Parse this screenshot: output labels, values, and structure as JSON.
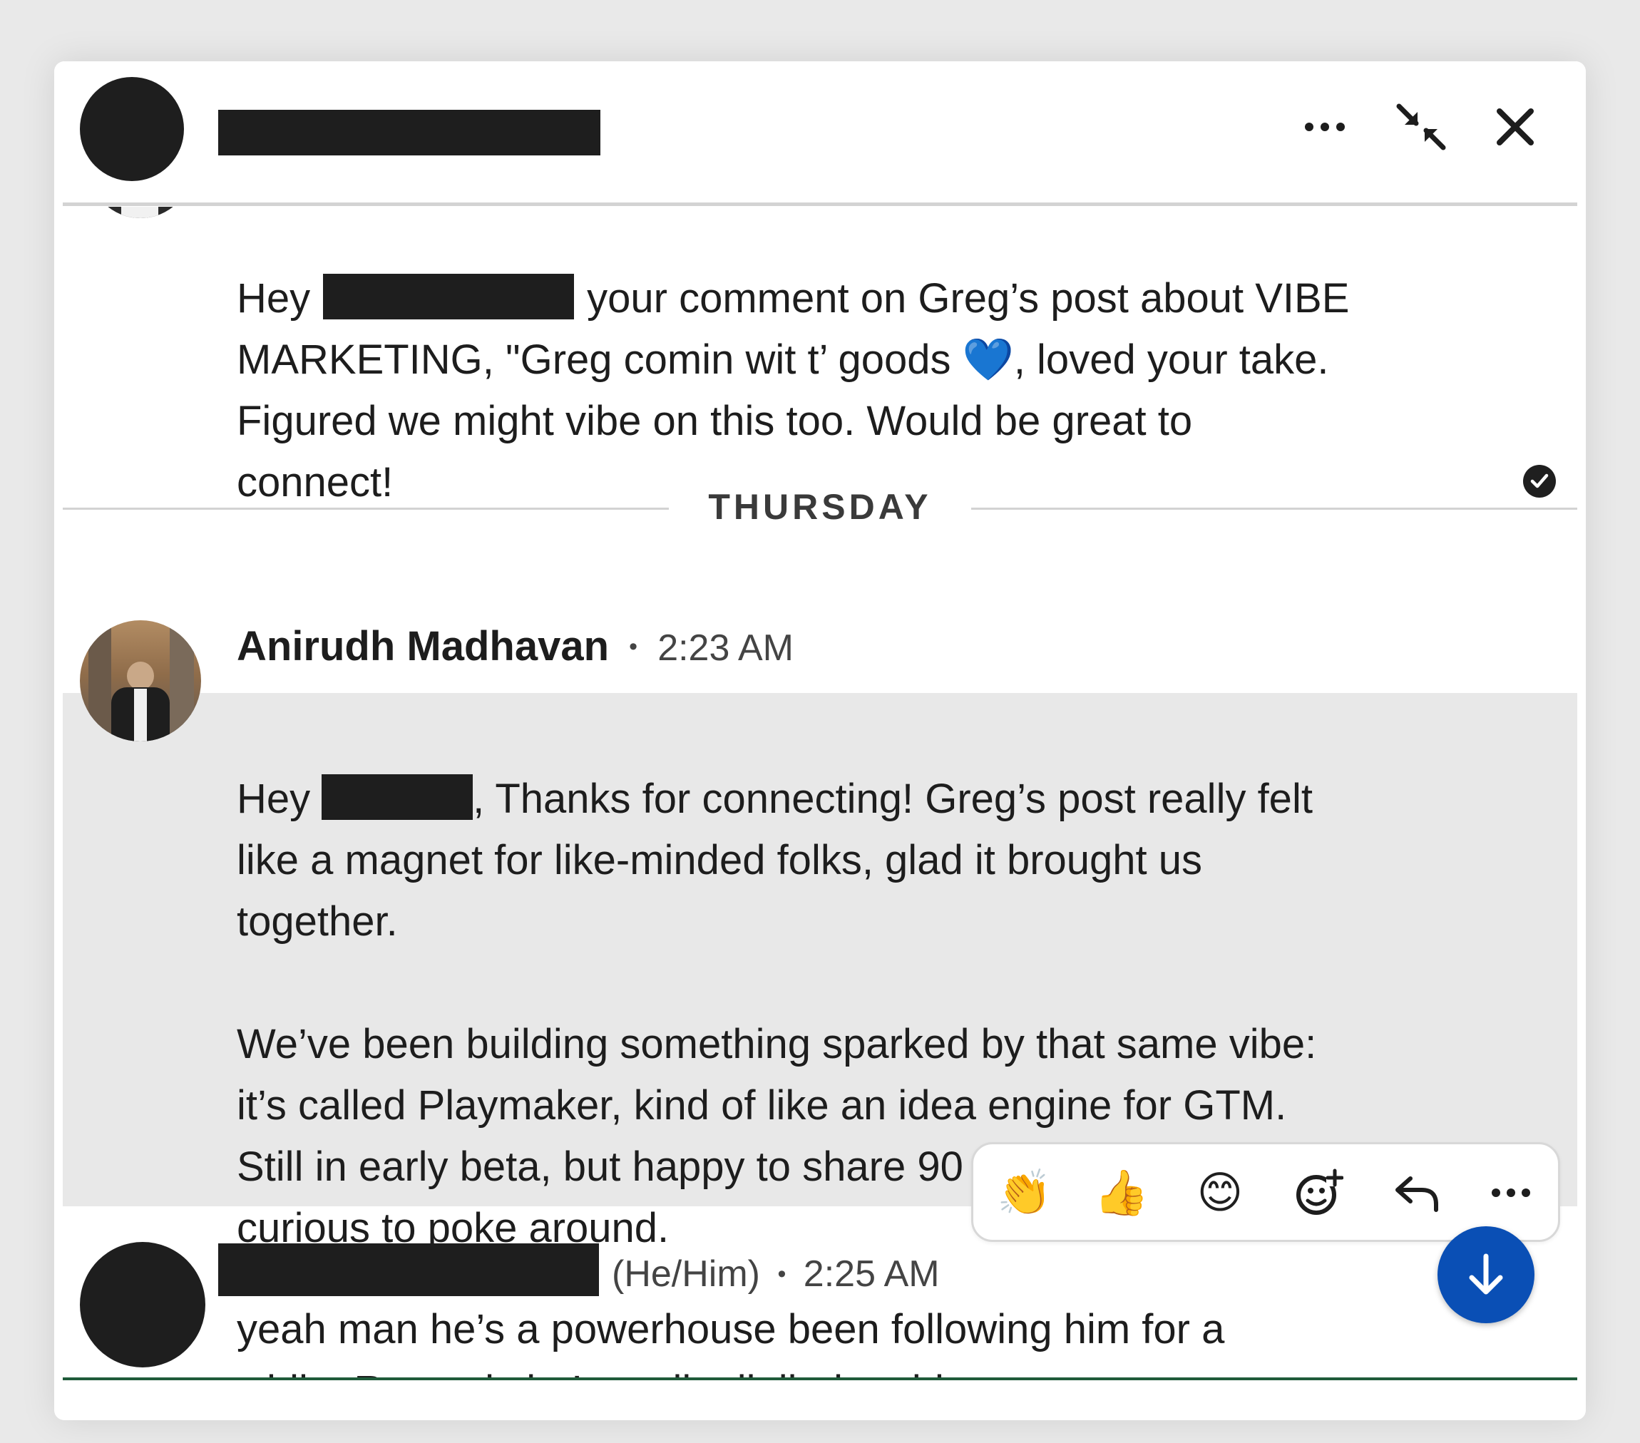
{
  "header": {
    "more_label": "More options",
    "minimize_label": "Minimize",
    "close_label": "Close"
  },
  "messages": [
    {
      "body_start": "Hey",
      "body_rest": "your comment on Greg’s post about VIBE\nMARKETING, \"Greg comin wit t’ goods 💙, loved your take.\nFigured we might vibe on this too. Would be great to\nconnect!"
    },
    {
      "sender": "Anirudh Madhavan",
      "time": "2:23 AM",
      "body_start": "Hey",
      "body_rest": ", Thanks for connecting! Greg’s post really felt\nlike a magnet for like-minded folks, glad it brought us\ntogether.\n\nWe’ve been building something sparked by that same vibe:\nit’s called Playmaker, kind of like an idea engine for GTM.\nStill in early beta, but happy to share 90 days free if you’re\ncurious to poke around."
    },
    {
      "pronouns": "(He/Him)",
      "time": "2:25 AM",
      "body": "yeah man he’s a powerhouse been following him for a\nwhile. Recently he’s really dialled up his content"
    }
  ],
  "date_divider": "THURSDAY",
  "separator": "•",
  "reactions": [
    {
      "name": "clap-emoji",
      "glyph": "👏"
    },
    {
      "name": "thumbs-up-emoji",
      "glyph": "👍"
    },
    {
      "name": "smile-emoji",
      "glyph": "😊"
    }
  ],
  "icons": [
    "ellipsis-icon",
    "minimize-icon",
    "close-icon",
    "check-icon",
    "add-reaction-icon",
    "reply-icon",
    "arrow-down-icon"
  ],
  "colors": {
    "accent_blue": "#0a4fb5",
    "divider_green": "#1f5b3a",
    "highlight_bg": "#e8e8e8"
  }
}
